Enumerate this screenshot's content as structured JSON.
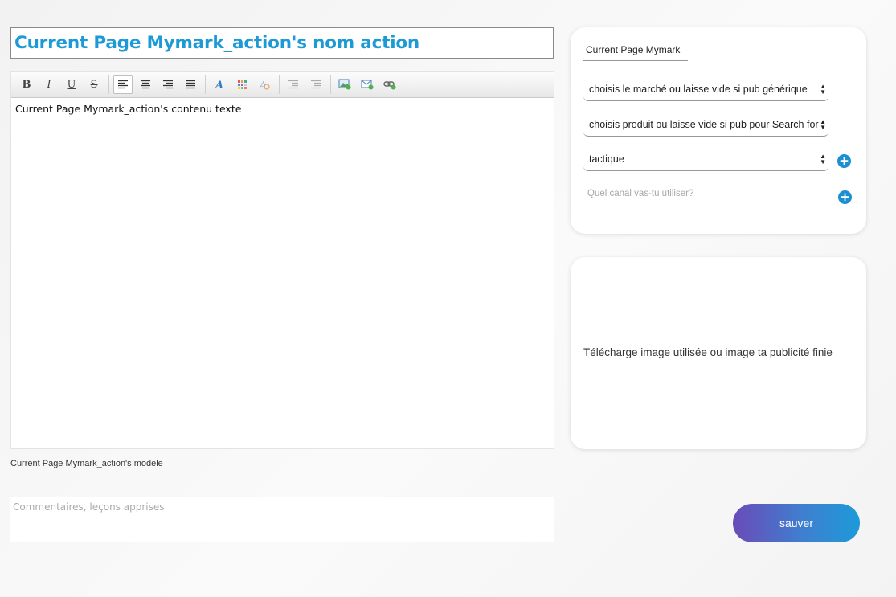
{
  "title_input": {
    "value": "Current Page Mymark_action's nom action"
  },
  "editor": {
    "toolbar": {
      "bold": "B",
      "italic": "I",
      "underline": "U",
      "strike": "S"
    },
    "content": "Current Page Mymark_action's contenu texte"
  },
  "model_label": "Current Page Mymark_action's modele",
  "comments": {
    "placeholder": "Commentaires, leçons apprises"
  },
  "right_panel": {
    "mymark_value": "Current Page Mymark",
    "select_market": "choisis le marché ou laisse vide si pub générique",
    "select_product": "choisis produit ou laisse vide si pub pour Search for",
    "select_tactic": "tactique",
    "canal_placeholder": "Quel canal vas-tu utiliser?"
  },
  "upload": {
    "text": "Télécharge image utilisée ou image ta publicité finie"
  },
  "save_button": "sauver",
  "colors": {
    "accent": "#1c9ad6",
    "button_gradient_start": "#6a4bb8",
    "button_gradient_end": "#1d9ad8"
  }
}
